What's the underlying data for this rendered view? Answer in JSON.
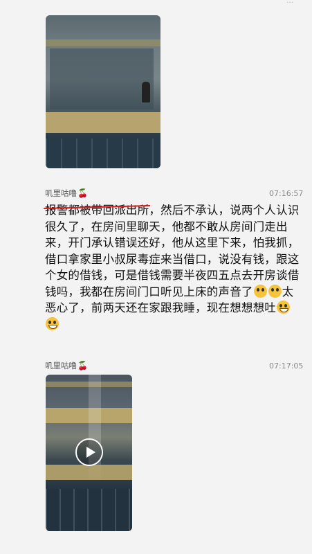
{
  "watermark_top": "...",
  "post2": {
    "author": "叽里咕噜",
    "author_icon": "cherry-icon",
    "time": "07:16:57",
    "text_struck": "报警都被带回派出所",
    "text_part1": "，然后不承认，说两个人认识很久了，在房间里聊天，他都不敢从房间门走出来，开门承认错误还好，他从这里下来，怕我抓，借口拿家里小叔尿毒症来当借口，说没有钱，跟这个女的借钱，可是借钱需要半夜四五点去开房谈借钱吗，我都在房间门口听见上床的声音了",
    "text_part2": "太恶心了，前两天还在家跟我睡，现在想想想吐"
  },
  "post3": {
    "author": "叽里咕噜",
    "author_icon": "cherry-icon",
    "time": "07:17:05",
    "video_icon": "play-icon"
  },
  "colors": {
    "strike": "#d81e1e",
    "cherry": "#c0131b",
    "time": "#888888"
  }
}
